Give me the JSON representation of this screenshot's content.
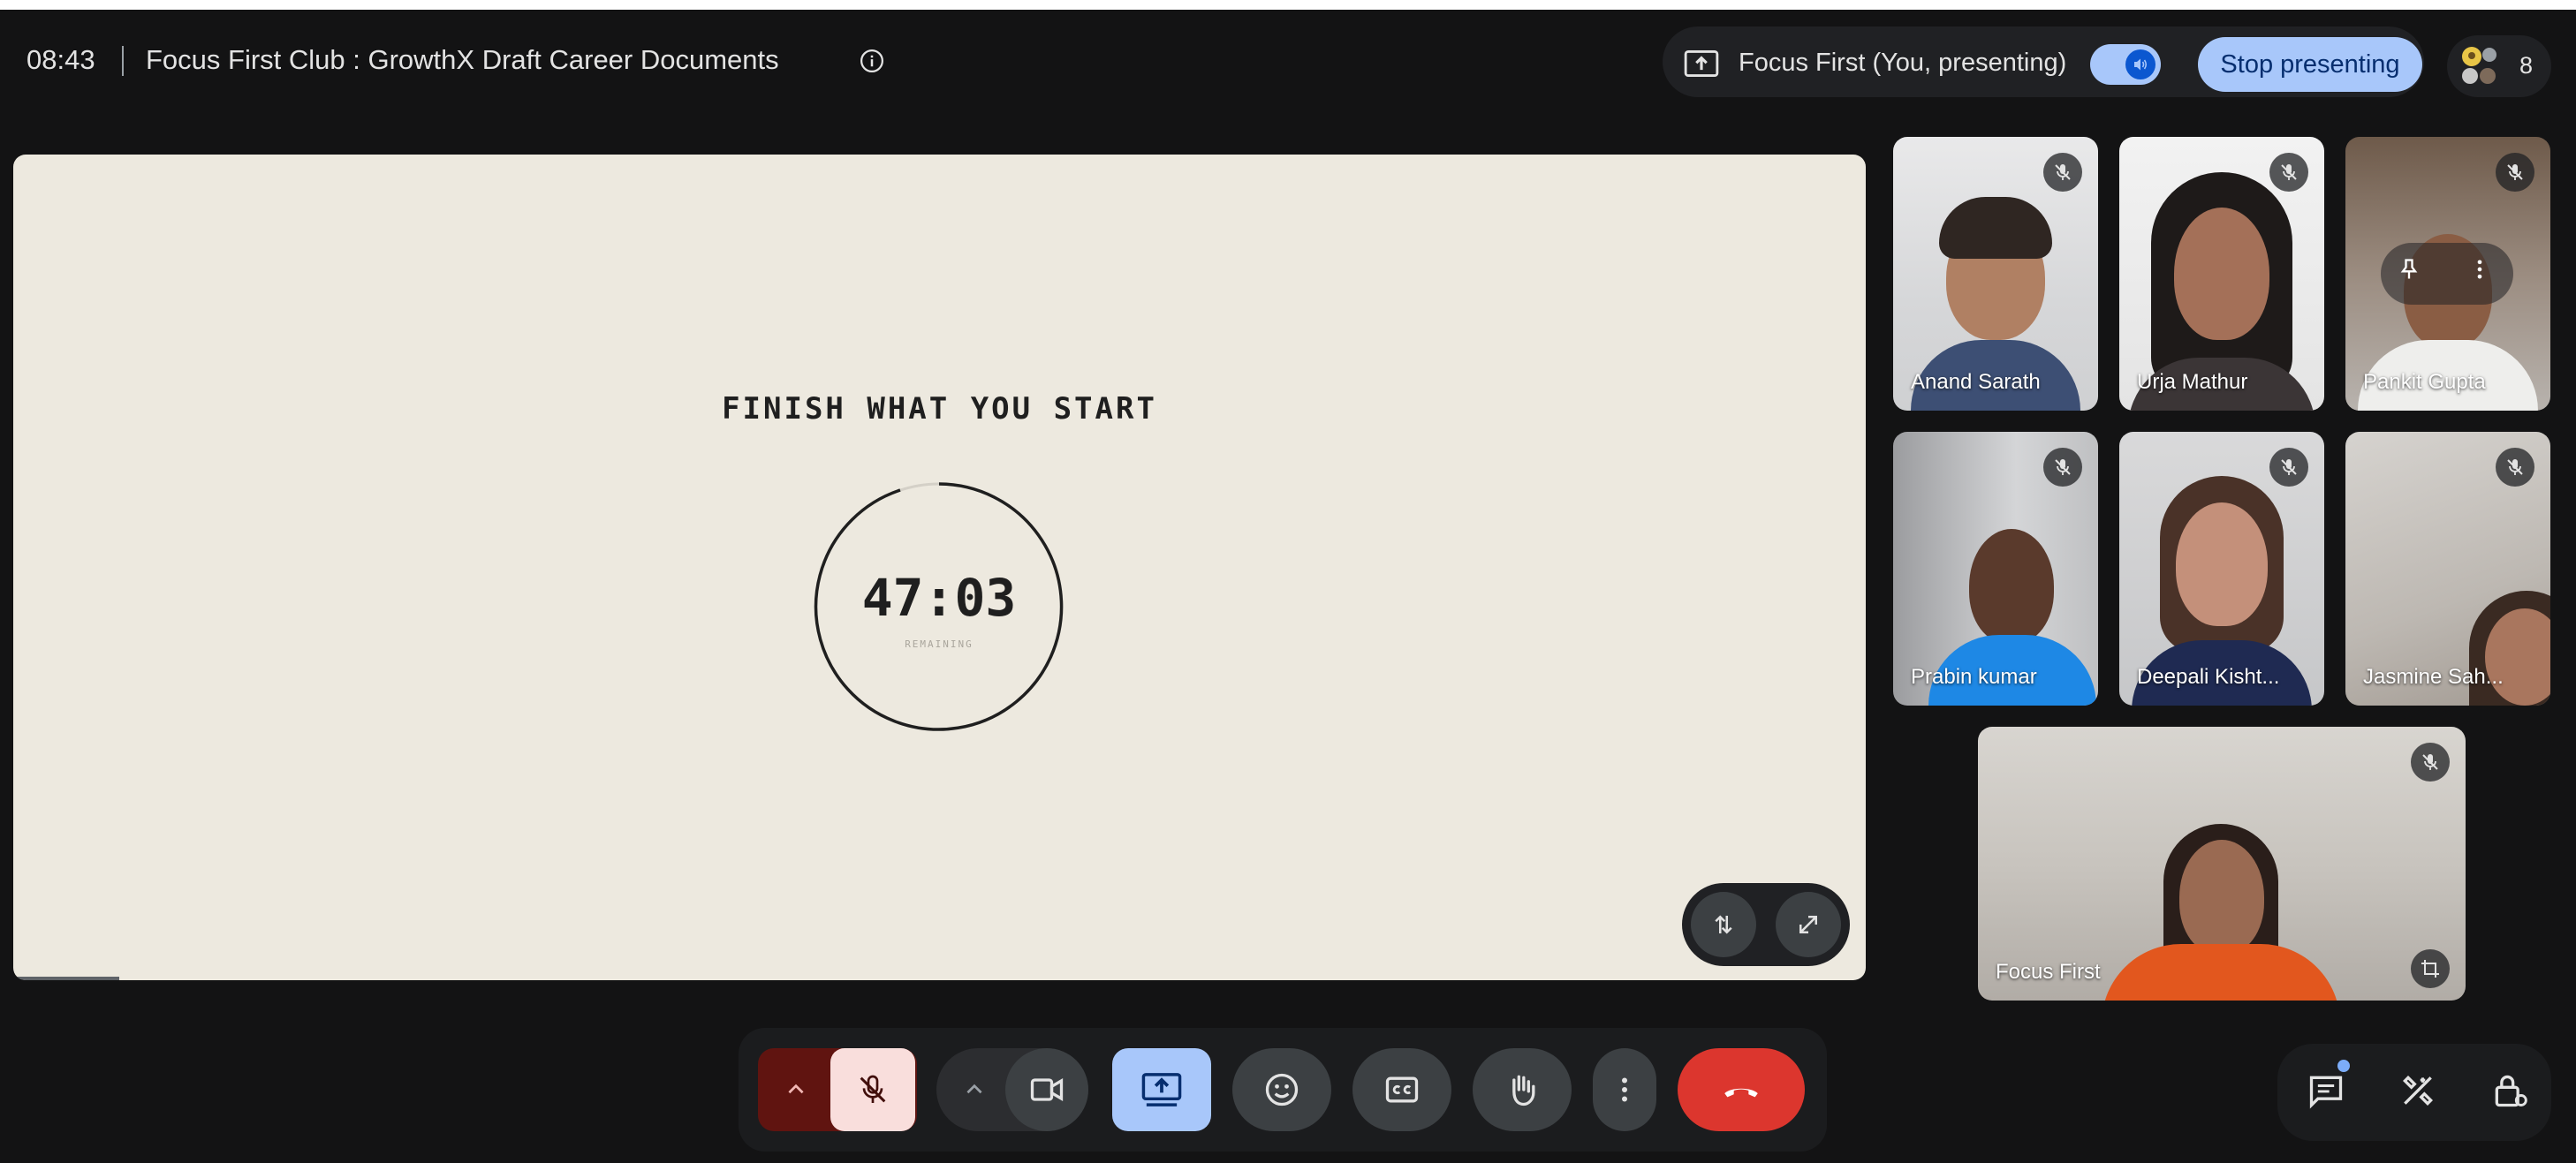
{
  "header": {
    "time": "08:43",
    "meeting_title": "Focus First Club : GrowthX Draft Career Documents",
    "presenting_label": "Focus First (You, presenting)",
    "stop_presenting_label": "Stop presenting",
    "participant_count": "8"
  },
  "presentation": {
    "headline": "FINISH WHAT YOU START",
    "timer_value": "47:03",
    "timer_caption": "REMAINING"
  },
  "participants": [
    {
      "name": "Anand Sarath",
      "muted": true
    },
    {
      "name": "Urja Mathur",
      "muted": true
    },
    {
      "name": "Pankit Gupta",
      "muted": true
    },
    {
      "name": "Prabin kumar",
      "muted": true
    },
    {
      "name": "Deepali Kisht...",
      "muted": true
    },
    {
      "name": "Jasmine Sah...",
      "muted": true
    },
    {
      "name": "Focus First",
      "muted": true
    }
  ],
  "icons": {
    "info": "info-icon",
    "present_screen": "present-screen-icon",
    "audio": "audio-icon",
    "mic_off": "mic-off-icon",
    "camera": "camera-icon",
    "emoji": "emoji-icon",
    "captions": "captions-icon",
    "raise_hand": "raise-hand-icon",
    "more": "more-vert-icon",
    "end_call": "end-call-icon",
    "chat": "chat-icon",
    "activities": "activities-icon",
    "host_controls": "host-controls-icon"
  },
  "colors": {
    "background": "#131314",
    "accent": "#a8c7fa",
    "end_call": "#dc362e",
    "mic_off_bg": "#f9dedc",
    "stage": "#ede9df"
  }
}
